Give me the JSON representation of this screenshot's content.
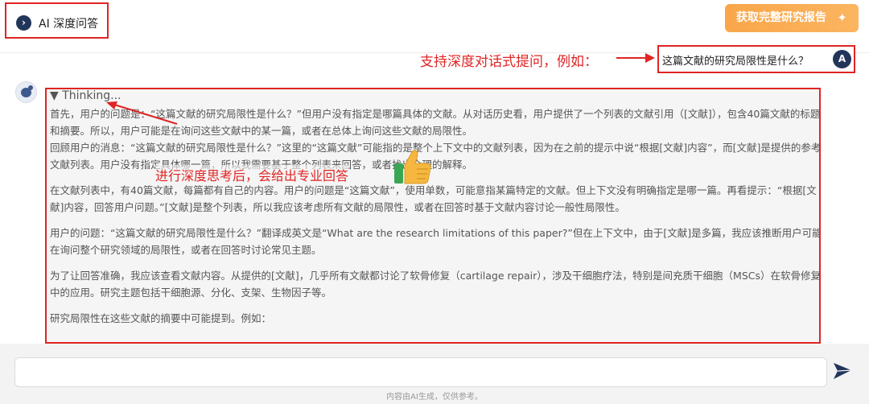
{
  "header": {
    "title": "AI 深度问答",
    "report_button": "获取完整研究报告"
  },
  "annotations": {
    "dialog": "支持深度对话式提问，例如：",
    "thinking": "进行深度思考后，会给出专业回答"
  },
  "user_message": {
    "text": "这篇文献的研究局限性是什么？",
    "avatar": "A"
  },
  "thinking": {
    "toggle": "▼ Thinking...",
    "paragraphs": [
      "首先，用户的问题是：“这篇文献的研究局限性是什么？”但用户没有指定是哪篇具体的文献。从对话历史看，用户提供了一个列表的文献引用（[文献]），包含40篇文献的标题和摘要。所以，用户可能是在询问这些文献中的某一篇，或者在总体上询问这些文献的局限性。",
      "回顾用户的消息：“这篇文献的研究局限性是什么？”这里的“这篇文献”可能指的是整个上下文中的文献列表，因为在之前的提示中说“根据[文献]内容”，而[文献]是提供的参考文献列表。用户没有指定具体哪一篇，所以我需要基于整个列表来回答，或者找出合理的解释。",
      "在文献列表中，有40篇文献，每篇都有自己的内容。用户的问题是“这篇文献”，使用单数，可能意指某篇特定的文献。但上下文没有明确指定是哪一篇。再看提示：“根据[文献]内容，回答用户问题。”[文献]是整个列表，所以我应该考虑所有文献的局限性，或者在回答时基于文献内容讨论一般性局限性。",
      "用户的问题：“这篇文献的研究局限性是什么？”翻译成英文是“What are the research limitations of this paper?”但在上下文中，由于[文献]是多篇，我应该推断用户可能在询问整个研究领域的局限性，或者在回答时讨论常见主题。",
      "为了让回答准确，我应该查看文献内容。从提供的[文献]，几乎所有文献都讨论了软骨修复（cartilage repair），涉及干细胞疗法，特别是间充质干细胞（MSCs）在软骨修复中的应用。研究主题包括干细胞源、分化、支架、生物因子等。",
      "研究局限性在这些文献的摘要中可能提到。例如："
    ]
  },
  "footer": {
    "input_value": "",
    "disclaimer": "内容由AI生成，仅供参考。"
  },
  "colors": {
    "annotation_red": "#e02424",
    "accent_navy": "#22355a",
    "report_orange": "#f9a64a"
  },
  "icons": [
    "chevron-right-icon",
    "sparkle-icon",
    "user-avatar",
    "ai-avatar-icon",
    "thumbs-up-icon",
    "send-icon"
  ]
}
